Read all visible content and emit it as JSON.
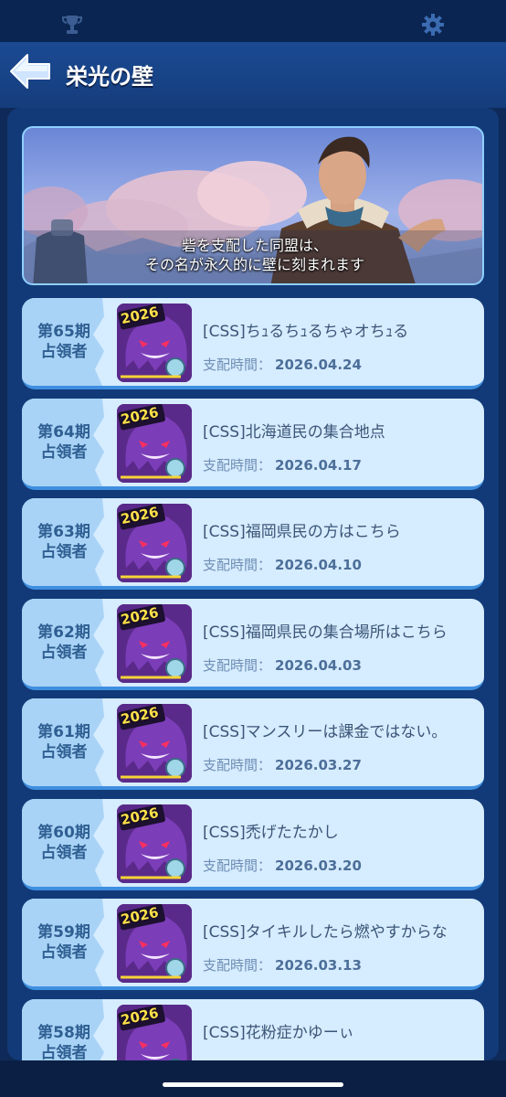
{
  "header": {
    "title": "栄光の壁",
    "icons": [
      "trophy-icon",
      "gear-icon",
      "back-arrow-icon"
    ]
  },
  "banner": {
    "line1": "砦を支配した同盟は、",
    "line2": "その名が永久的に壁に刻まれます"
  },
  "entries": [
    {
      "period": "第65期",
      "role": "占領者",
      "badge": "2026",
      "alliance": "[CSS]ちｭるちｭるちゃオちｭる",
      "dom_label": "支配時間：",
      "date": "2026.04.24"
    },
    {
      "period": "第64期",
      "role": "占領者",
      "badge": "2026",
      "alliance": "[CSS]北海道民の集合地点",
      "dom_label": "支配時間：",
      "date": "2026.04.17"
    },
    {
      "period": "第63期",
      "role": "占領者",
      "badge": "2026",
      "alliance": "[CSS]福岡県民の方はこちら",
      "dom_label": "支配時間：",
      "date": "2026.04.10"
    },
    {
      "period": "第62期",
      "role": "占領者",
      "badge": "2026",
      "alliance": "[CSS]福岡県民の集合場所はこちら",
      "dom_label": "支配時間：",
      "date": "2026.04.03"
    },
    {
      "period": "第61期",
      "role": "占領者",
      "badge": "2026",
      "alliance": "[CSS]マンスリーは課金ではない。",
      "dom_label": "支配時間：",
      "date": "2026.03.27"
    },
    {
      "period": "第60期",
      "role": "占領者",
      "badge": "2026",
      "alliance": "[CSS]禿げたたかし",
      "dom_label": "支配時間：",
      "date": "2026.03.20"
    },
    {
      "period": "第59期",
      "role": "占領者",
      "badge": "2026",
      "alliance": "[CSS]タイキルしたら燃やすからな",
      "dom_label": "支配時間：",
      "date": "2026.03.13"
    },
    {
      "period": "第58期",
      "role": "占領者",
      "badge": "2026",
      "alliance": "[CSS]花粉症かゆーぃ",
      "dom_label": "",
      "date": ""
    }
  ],
  "colors": {
    "accent": "#3f8fe0",
    "card_bg": "#d6ecff",
    "emblem_purple": "#5a2a8a"
  }
}
